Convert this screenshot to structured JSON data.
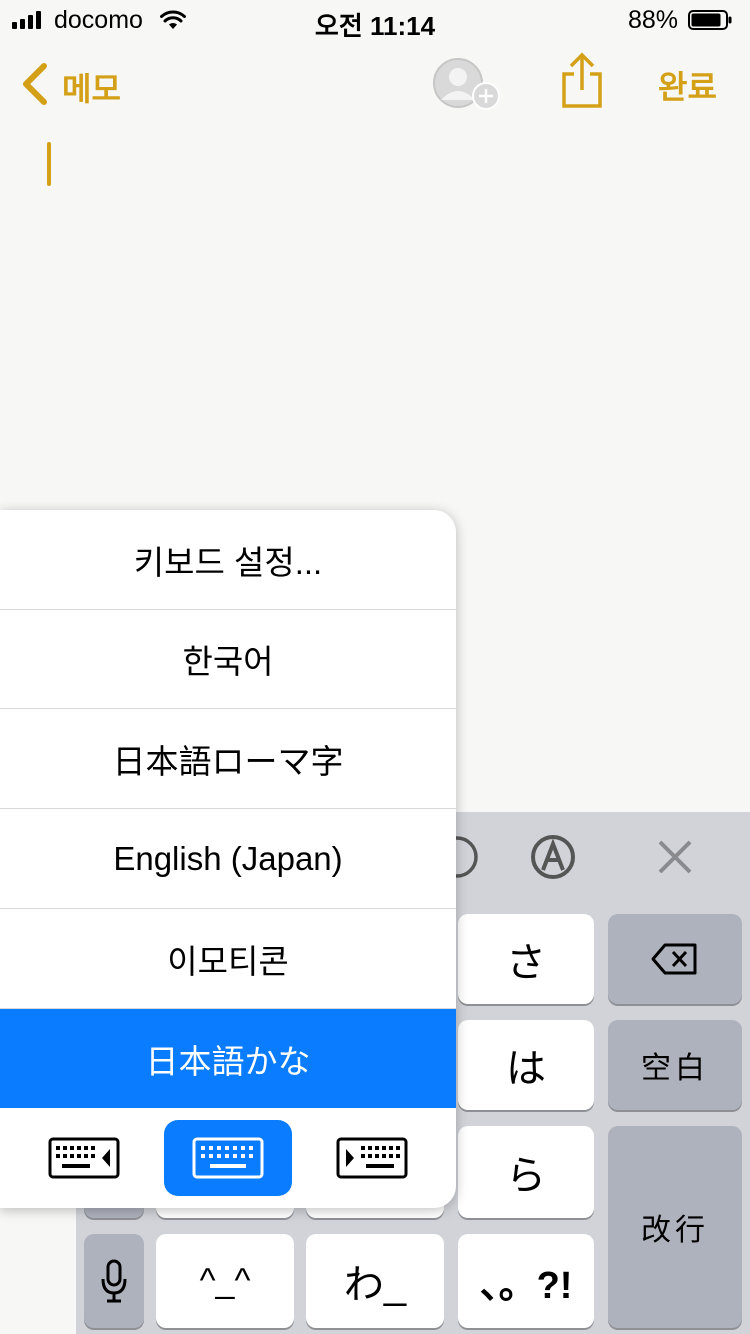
{
  "status_bar": {
    "carrier": "docomo",
    "time": "오전 11:14",
    "battery_percent": "88%",
    "battery_level": 0.88
  },
  "nav": {
    "back_label": "메모",
    "done_label": "완료"
  },
  "keyboard": {
    "keys": {
      "sa": "さ",
      "ha": "は",
      "ra": "ら",
      "emoticon": "^_^",
      "wa": "わ_",
      "punct": "、。?!",
      "space": "空白",
      "return": "改行"
    }
  },
  "language_menu": {
    "items": [
      "키보드 설정...",
      "한국어",
      "日本語ローマ字",
      "English (Japan)",
      "이모티콘",
      "日本語かな"
    ],
    "selected_index": 5,
    "layout_options": [
      "left-keyboard",
      "full-keyboard",
      "right-keyboard"
    ],
    "active_layout": "full-keyboard"
  },
  "colors": {
    "accent": "#d4a017",
    "selection": "#0a7cff",
    "keyboard_bg": "#d1d3d9",
    "special_key": "#aeb2bc"
  }
}
